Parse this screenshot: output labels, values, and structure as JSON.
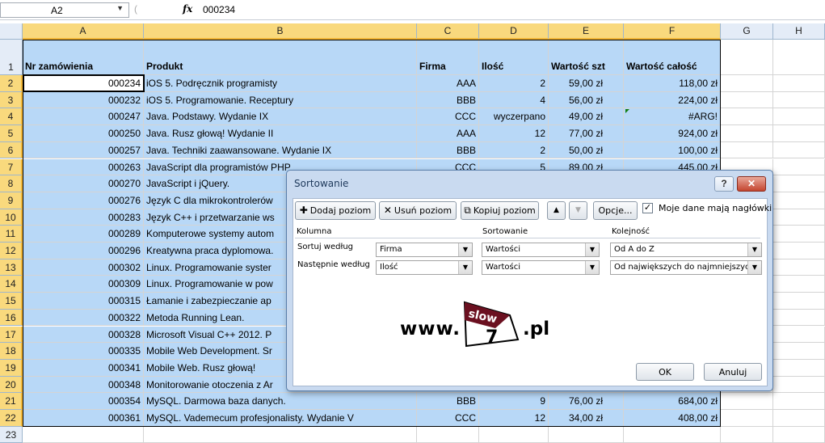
{
  "formula_bar": {
    "name_box": "A2",
    "fx": "fx",
    "value": "000234"
  },
  "columns": [
    "A",
    "B",
    "C",
    "D",
    "E",
    "F",
    "G",
    "H"
  ],
  "row_numbers": [
    "1",
    "2",
    "3",
    "4",
    "5",
    "6",
    "7",
    "8",
    "9",
    "10",
    "11",
    "12",
    "13",
    "14",
    "15",
    "16",
    "17",
    "18",
    "19",
    "20",
    "21",
    "22",
    "23"
  ],
  "headers": {
    "a": "Nr zamówienia",
    "b": "Produkt",
    "c": "Firma",
    "d": "Ilość",
    "e": "Wartość szt",
    "f": "Wartość całość"
  },
  "rows": [
    {
      "a": "000234",
      "b": "iOS 5. Podręcznik programisty",
      "c": "AAA",
      "d": "2",
      "e": "59,00 zł",
      "f": "118,00 zł"
    },
    {
      "a": "000232",
      "b": "iOS 5. Programowanie. Receptury",
      "c": "BBB",
      "d": "4",
      "e": "56,00 zł",
      "f": "224,00 zł"
    },
    {
      "a": "000247",
      "b": "Java. Podstawy. Wydanie IX",
      "c": "CCC",
      "d": "wyczerpano",
      "e": "49,00 zł",
      "f": "#ARG!"
    },
    {
      "a": "000250",
      "b": "Java. Rusz głową! Wydanie II",
      "c": "AAA",
      "d": "12",
      "e": "77,00 zł",
      "f": "924,00 zł"
    },
    {
      "a": "000257",
      "b": "Java. Techniki zaawansowane. Wydanie IX",
      "c": "BBB",
      "d": "2",
      "e": "50,00 zł",
      "f": "100,00 zł"
    },
    {
      "a": "000263",
      "b": "JavaScript dla programistów PHP",
      "c": "CCC",
      "d": "5",
      "e": "89,00 zł",
      "f": "445,00 zł"
    },
    {
      "a": "000270",
      "b": "JavaScript i jQuery.",
      "c": "",
      "d": "",
      "e": "",
      "f": ""
    },
    {
      "a": "000276",
      "b": "Język C dla mikrokontrolerów",
      "c": "",
      "d": "",
      "e": "",
      "f": ""
    },
    {
      "a": "000283",
      "b": "Język C++ i przetwarzanie ws",
      "c": "",
      "d": "",
      "e": "",
      "f": ""
    },
    {
      "a": "000289",
      "b": "Komputerowe systemy autom",
      "c": "",
      "d": "",
      "e": "",
      "f": ""
    },
    {
      "a": "000296",
      "b": "Kreatywna praca dyplomowa.",
      "c": "",
      "d": "",
      "e": "",
      "f": ""
    },
    {
      "a": "000302",
      "b": "Linux. Programowanie syster",
      "c": "",
      "d": "",
      "e": "",
      "f": ""
    },
    {
      "a": "000309",
      "b": "Linux. Programowanie w pow",
      "c": "",
      "d": "",
      "e": "",
      "f": ""
    },
    {
      "a": "000315",
      "b": "Łamanie i zabezpieczanie ap",
      "c": "",
      "d": "",
      "e": "",
      "f": ""
    },
    {
      "a": "000322",
      "b": "Metoda Running Lean.",
      "c": "",
      "d": "",
      "e": "",
      "f": ""
    },
    {
      "a": "000328",
      "b": "Microsoft Visual C++ 2012. P",
      "c": "",
      "d": "",
      "e": "",
      "f": ""
    },
    {
      "a": "000335",
      "b": "Mobile Web Development. Sr",
      "c": "",
      "d": "",
      "e": "",
      "f": ""
    },
    {
      "a": "000341",
      "b": "Mobile Web. Rusz głową!",
      "c": "",
      "d": "",
      "e": "",
      "f": ""
    },
    {
      "a": "000348",
      "b": "Monitorowanie otoczenia z Ar",
      "c": "",
      "d": "",
      "e": "",
      "f": ""
    },
    {
      "a": "000354",
      "b": "MySQL. Darmowa baza danych.",
      "c": "BBB",
      "d": "9",
      "e": "76,00 zł",
      "f": "684,00 zł"
    },
    {
      "a": "000361",
      "b": "MySQL. Vademecum profesjonalisty. Wydanie V",
      "c": "CCC",
      "d": "12",
      "e": "34,00 zł",
      "f": "408,00 zł"
    }
  ],
  "dialog": {
    "title": "Sortowanie",
    "help": "?",
    "close": "✕",
    "add_level": "Dodaj poziom",
    "delete_level": "Usuń poziom",
    "copy_level": "Kopiuj poziom",
    "up": "▲",
    "down": "▼",
    "options": "Opcje...",
    "header_checkbox_label": "Moje dane mają nagłówki",
    "header_checked": "✓",
    "col_column": "Kolumna",
    "col_sort_on": "Sortowanie",
    "col_order": "Kolejność",
    "levels": [
      {
        "label": "Sortuj według",
        "column": "Firma",
        "sort_on": "Wartości",
        "order": "Od A do Z"
      },
      {
        "label": "Następnie według",
        "column": "Ilość",
        "sort_on": "Wartości",
        "order": "Od największych do najmniejszych"
      }
    ],
    "logo": {
      "left": "www.",
      "top_word": "slow",
      "digit": "7",
      "right": ".pl"
    },
    "ok": "OK",
    "cancel": "Anuluj"
  }
}
